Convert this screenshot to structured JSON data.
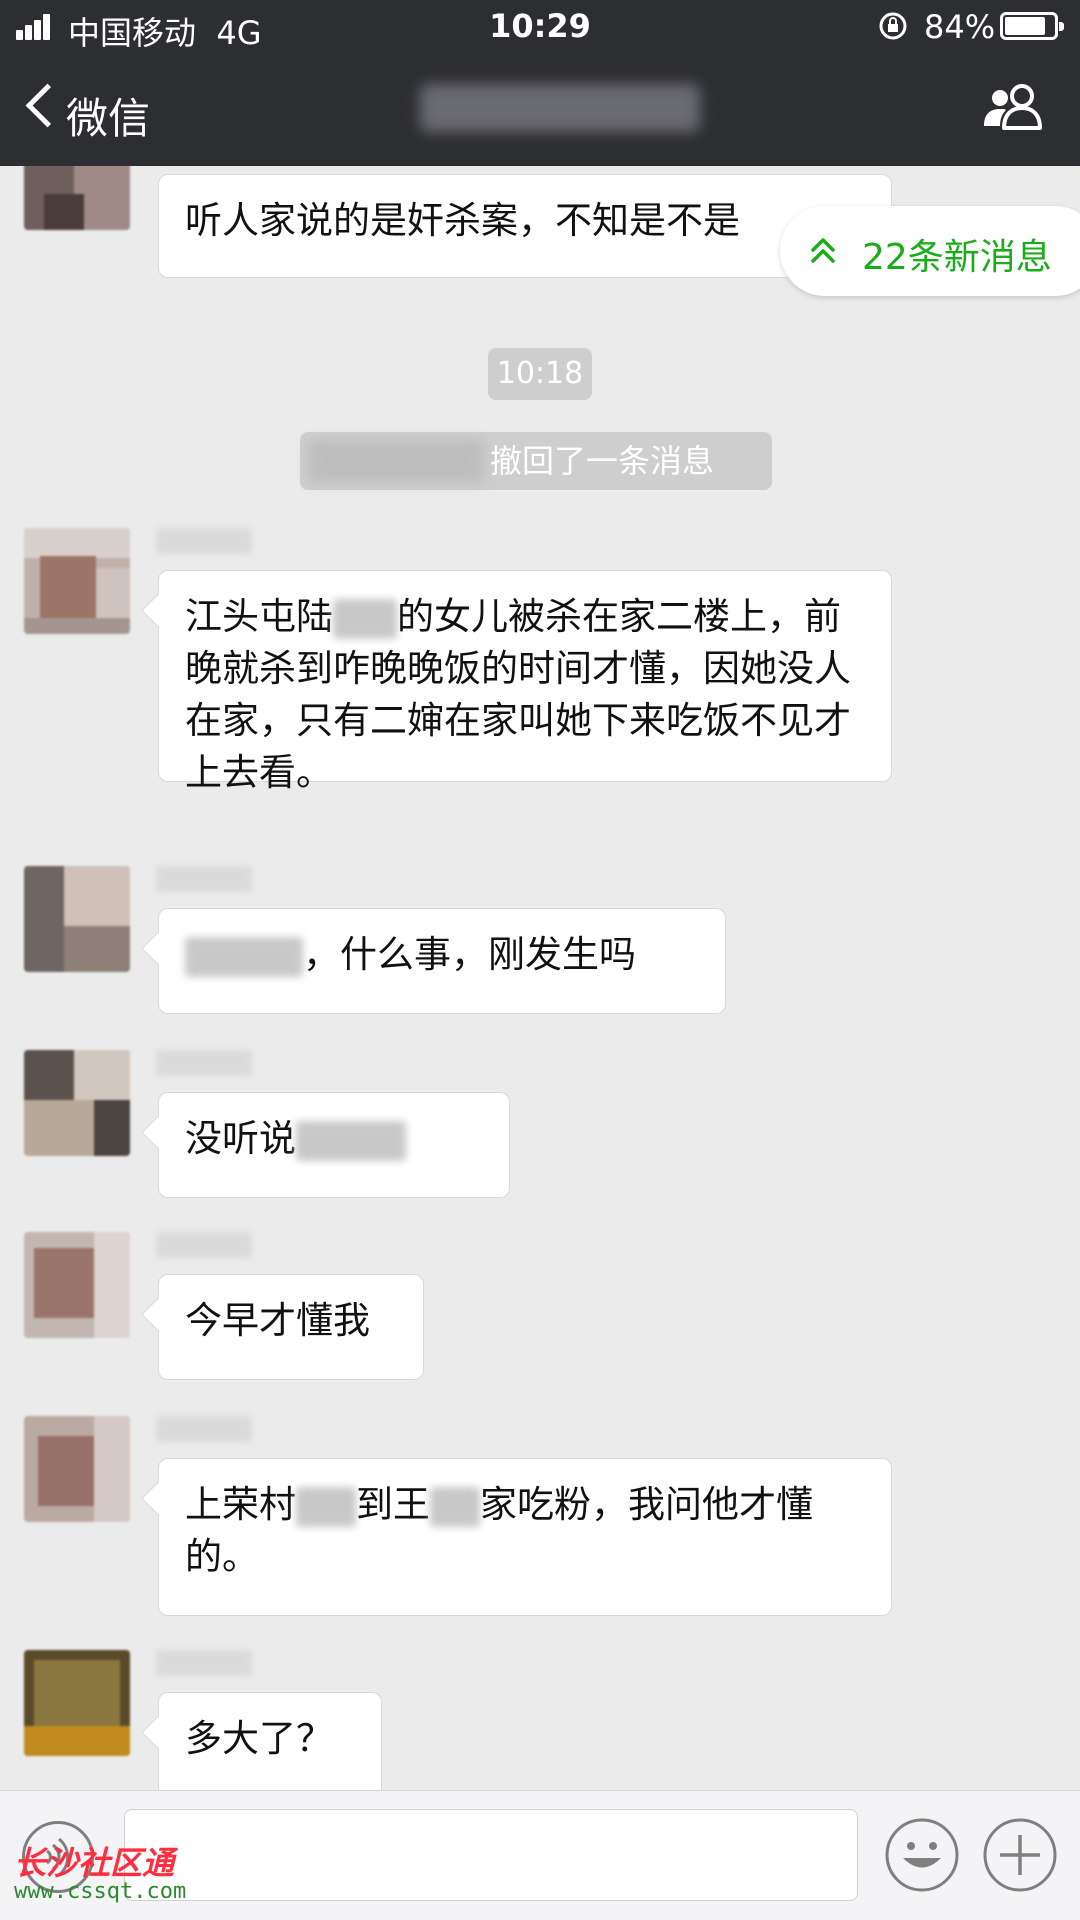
{
  "status_bar": {
    "carrier": "中国移动",
    "network": "4G",
    "time": "10:29",
    "battery": "84%",
    "battery_level": 0.84
  },
  "nav": {
    "back_label": "微信",
    "group_icon": "group-members-icon"
  },
  "new_messages_pill": {
    "label": "22条新消息",
    "icon": "double-chevron-up-icon"
  },
  "chat": {
    "time_divider": "10:18",
    "recall_notice": "撤回了一条消息",
    "messages": [
      {
        "text": "听人家说的是奸杀案，不知是不是"
      },
      {
        "line1_a": "江头屯陆",
        "line1_b": "的女儿被杀在家二楼",
        "rest": "上，前晚就杀到咋晚晚饭的时间才懂，因她没人在家，只有二婶在家叫她下来吃饭不见才上去看。"
      },
      {
        "text": "，什么事，刚发生吗"
      },
      {
        "text": "没听说"
      },
      {
        "text": "今早才懂我"
      },
      {
        "part_a": "上荣村",
        "part_b": "到王",
        "part_c": "家吃粉，我问他才懂的。"
      },
      {
        "text": "多大了？"
      }
    ]
  },
  "input_bar": {
    "voice_icon": "voice-icon",
    "emoji_icon": "emoji-icon",
    "plus_icon": "plus-icon"
  },
  "watermark": {
    "brand": "长沙社区通",
    "site": "www.cssqt.com"
  },
  "colors": {
    "bar_bg": "#2d2e32",
    "chat_bg": "#ebebeb",
    "accent_green": "#1aad19"
  }
}
